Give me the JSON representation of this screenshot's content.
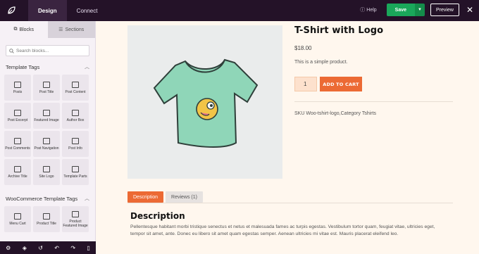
{
  "topbar": {
    "tabs": [
      "Design",
      "Connect"
    ],
    "help_label": "Help",
    "save_label": "Save",
    "preview_label": "Preview"
  },
  "sidebar": {
    "tabs": [
      "Blocks",
      "Sections"
    ],
    "search_placeholder": "Search blocks...",
    "template_tags_title": "Template Tags",
    "template_tags": [
      "Posts",
      "Post Title",
      "Post Content",
      "Post Excerpt",
      "Featured Image",
      "Author Box",
      "Post Comments",
      "Post Navigation",
      "Post Info",
      "Archive Title",
      "Site Logo",
      "Template Parts"
    ],
    "woo_title": "WooCommerce Template Tags",
    "woo_tags": [
      "Menu Cart",
      "Product Title",
      "Product Featured Image"
    ]
  },
  "product": {
    "title": "T-Shirt with Logo",
    "price": "$18.00",
    "short_description": "This is a simple product.",
    "quantity": "1",
    "add_to_cart": "ADD TO CART",
    "sku": "SKU Woo-tshirt-logo,Category Tshirts",
    "tabs": [
      "Description",
      "Reviews (1)"
    ],
    "description_title": "Description",
    "description_body": "Pellentesque habitant morbi tristique senectus et netus et malesuada fames ac turpis egestas. Vestibulum tortor quam, feugiat vitae, ultricies eget, tempor sit amet, ante. Donec eu libero sit amet quam egestas semper. Aenean ultricies mi vitae est. Mauris placerat eleifend leo."
  },
  "colors": {
    "topbar": "#241228",
    "save": "#1aa75a",
    "accent": "#ec6a34",
    "canvas_bg": "#fff7ee"
  }
}
